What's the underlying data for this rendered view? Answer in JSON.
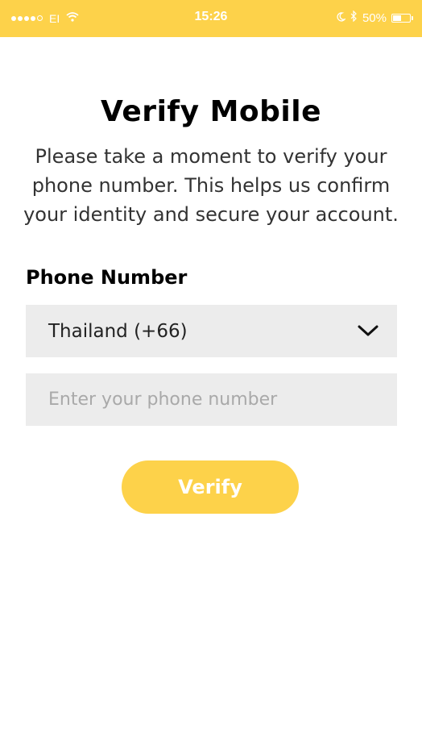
{
  "status_bar": {
    "carrier": "EI",
    "time": "15:26",
    "battery_percent_label": "50%",
    "battery_level": 0.5,
    "signal_bars_filled": 4,
    "signal_bars_total": 5
  },
  "colors": {
    "accent": "#fdd24a",
    "input_background": "#ececec"
  },
  "page": {
    "title": "Verify Mobile",
    "description": "Please take a moment to verify your phone number. This helps us confirm your identity and secure your account."
  },
  "form": {
    "phone_label": "Phone Number",
    "country_selected": "Thailand (+66)",
    "phone_value": "",
    "phone_placeholder": "Enter your phone number",
    "verify_label": "Verify"
  },
  "icons": {
    "country_dropdown": "chevron-down-icon",
    "wifi": "wifi-icon",
    "moon": "moon-icon",
    "bluetooth": "bluetooth-icon",
    "battery": "battery-icon"
  }
}
